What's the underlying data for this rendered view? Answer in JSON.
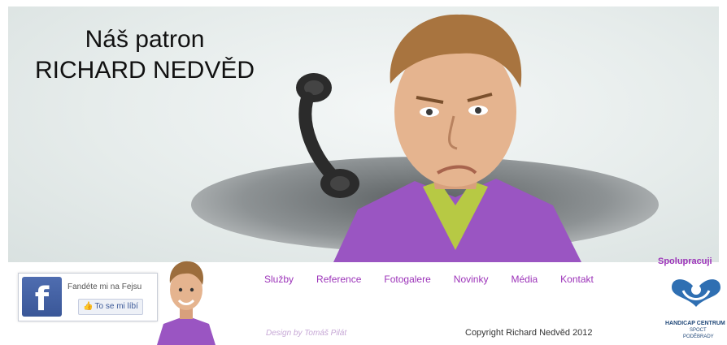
{
  "hero": {
    "title_line1": "Náš patron",
    "title_line2": "RICHARD NEDVĚD"
  },
  "nav": {
    "items": [
      "Služby",
      "Reference",
      "Fotogalere",
      "Novinky",
      "Média",
      "Kontakt"
    ]
  },
  "footer": {
    "credit": "Design by Tomáš Pilát",
    "copyright": "Copyright  Richard Nedvěd 2012"
  },
  "facebook": {
    "text": "Fandéte mi na Fejsu",
    "like_label": "To se mi líbí"
  },
  "partners": {
    "title": "Spolupracuji",
    "logo_line1": "HANDICAP CENTRUM",
    "logo_line2": "SPOCT",
    "logo_line3": "PODĚBRADY"
  },
  "colors": {
    "accent": "#9c33b9",
    "facebook": "#3b5998",
    "shirt": "#9a55c2"
  }
}
